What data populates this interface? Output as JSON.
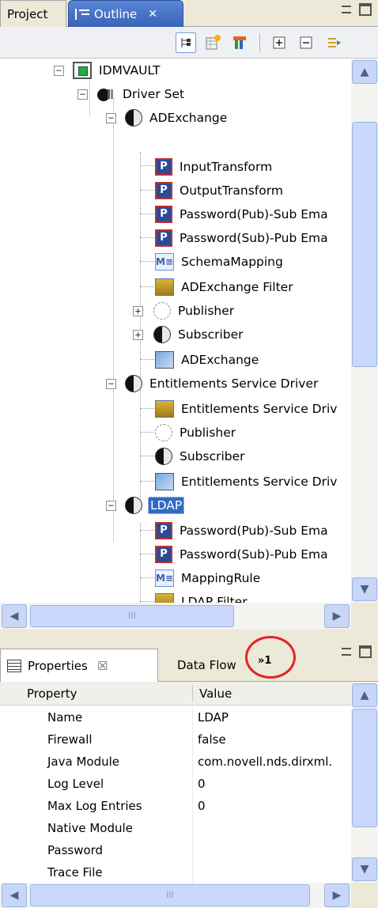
{
  "outline_panel": {
    "tabs": [
      {
        "label": "Project",
        "active": false
      },
      {
        "label": "Outline",
        "active": true,
        "close_glyph": "✕"
      }
    ],
    "toolbar_icons": [
      "hierarchy-view-icon",
      "new-item-icon",
      "filter-icon",
      "expand-all-icon",
      "collapse-all-icon",
      "sort-icon"
    ],
    "tree": [
      {
        "label": "IDMVAULT",
        "icon": "vault-icon",
        "level": 0,
        "expander": "−"
      },
      {
        "label": "Driver Set",
        "icon": "driver-set-icon",
        "level": 1,
        "expander": "−"
      },
      {
        "label": "ADExchange",
        "icon": "driver-icon",
        "level": 2,
        "expander": "−"
      },
      {
        "label": "InputTransform",
        "icon": "policy-icon",
        "level": 3
      },
      {
        "label": "OutputTransform",
        "icon": "policy-icon",
        "level": 3
      },
      {
        "label": "Password(Pub)-Sub Ema",
        "icon": "policy-icon",
        "level": 3
      },
      {
        "label": "Password(Sub)-Pub Ema",
        "icon": "policy-icon",
        "level": 3
      },
      {
        "label": "SchemaMapping",
        "icon": "mapping-icon",
        "level": 3
      },
      {
        "label": "ADExchange Filter",
        "icon": "filter-icon",
        "level": 3
      },
      {
        "label": "Publisher",
        "icon": "publisher-icon",
        "level": 3,
        "expander": "+"
      },
      {
        "label": "Subscriber",
        "icon": "subscriber-icon",
        "level": 3,
        "expander": "+"
      },
      {
        "label": "ADExchange",
        "icon": "application-icon",
        "level": 3
      },
      {
        "label": "Entitlements Service Driver",
        "icon": "driver-icon",
        "level": 2,
        "expander": "−"
      },
      {
        "label": "Entitlements Service Driv",
        "icon": "filter-icon",
        "level": 3
      },
      {
        "label": "Publisher",
        "icon": "publisher-icon",
        "level": 3
      },
      {
        "label": "Subscriber",
        "icon": "subscriber-icon",
        "level": 3
      },
      {
        "label": "Entitlements Service Driv",
        "icon": "application-icon",
        "level": 3
      },
      {
        "label": "LDAP",
        "icon": "driver-icon",
        "level": 2,
        "expander": "−",
        "selected": true
      },
      {
        "label": "Password(Pub)-Sub Ema",
        "icon": "policy-icon",
        "level": 3
      },
      {
        "label": "Password(Sub)-Pub Ema",
        "icon": "policy-icon",
        "level": 3
      },
      {
        "label": "MappingRule",
        "icon": "mapping-icon",
        "level": 3
      },
      {
        "label": "LDAP Filter",
        "icon": "filter-icon",
        "level": 3
      }
    ],
    "hscroll_grip": "III"
  },
  "properties_panel": {
    "tabs": [
      {
        "label": "Properties",
        "active": true,
        "close_glyph": "☒"
      },
      {
        "label": "Data Flow",
        "active": false
      },
      {
        "label": "»1",
        "active": false
      }
    ],
    "columns": [
      "Property",
      "Value"
    ],
    "rows": [
      {
        "property": "Name",
        "value": "LDAP"
      },
      {
        "property": "Firewall",
        "value": "false"
      },
      {
        "property": "Java Module",
        "value": "com.novell.nds.dirxml."
      },
      {
        "property": "Log Level",
        "value": "0"
      },
      {
        "property": "Max Log Entries",
        "value": "0"
      },
      {
        "property": "Native Module",
        "value": ""
      },
      {
        "property": "Password",
        "value": ""
      },
      {
        "property": "Trace File",
        "value": ""
      }
    ],
    "hscroll_grip": "III"
  },
  "colors": {
    "selection": "#316ac5",
    "annotation_circle": "#e0242a",
    "tab_active": "#3a63b8",
    "panel_bg": "#ece9d8"
  }
}
